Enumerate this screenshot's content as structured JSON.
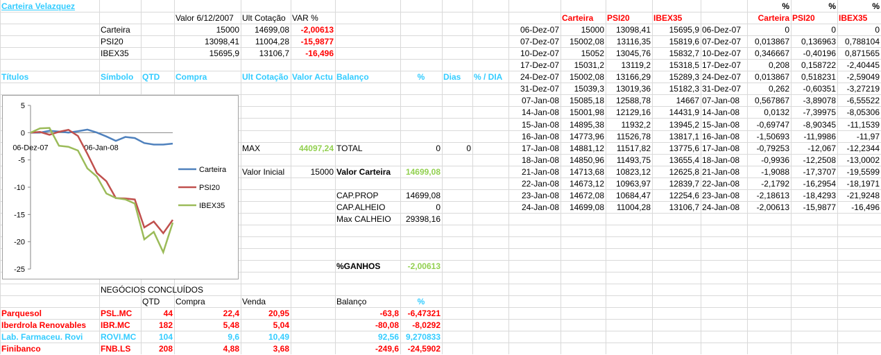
{
  "title": "Carteira Velazquez",
  "summary": {
    "headers": [
      "Valor 6/12/2007",
      "Ult Cotação",
      "VAR %"
    ],
    "rows": [
      {
        "name": "Carteira",
        "valor": "15000",
        "ult": "14699,08",
        "var": "-2,00613"
      },
      {
        "name": "PSI20",
        "valor": "13098,41",
        "ult": "11004,28",
        "var": "-15,9877"
      },
      {
        "name": "IBEX35",
        "valor": "15695,9",
        "ult": "13106,7",
        "var": "-16,496"
      }
    ]
  },
  "titulos_headers": {
    "titulos": "Títulos",
    "simbolo": "Símbolo",
    "qtd": "QTD",
    "compra": "Compra",
    "ult": "Ult Cotação",
    "valor": "Valor Actu",
    "balanco": "Balanço",
    "pct": "%",
    "dias": "Dias",
    "pctdia": "% / DIA"
  },
  "stats": {
    "max_label": "MAX",
    "max_value": "44097,24",
    "total_label": "TOTAL",
    "total_value": "0",
    "total_value2": "0",
    "vinicial_label": "Valor Inicial",
    "vinicial_value": "15000",
    "vcarteira_label": "Valor Carteira",
    "vcarteira_value": "14699,08",
    "capprop_label": "CAP.PROP",
    "capprop_value": "14699,08",
    "capalheio_label": "CAP.ALHEIO",
    "capalheio_value": "0",
    "maxcalheio_label": "Max CALHEIO",
    "maxcalheio_value": "29398,16",
    "ganhos_label": "%GANHOS",
    "ganhos_value": "-2,00613"
  },
  "negocios": {
    "title": "NEGÓCIOS CONCLUÍDOS",
    "headers": {
      "qtd": "QTD",
      "compra": "Compra",
      "venda": "Venda",
      "balanco": "Balanço",
      "pct": "%"
    },
    "rows": [
      {
        "name": "Parquesol",
        "symbol": "PSL.MC",
        "qtd": "44",
        "compra": "22,4",
        "venda": "20,95",
        "balanco": "-63,8",
        "pct": "-6,47321",
        "color": "#ff0000"
      },
      {
        "name": "Iberdrola Renovables",
        "symbol": "IBR.MC",
        "qtd": "182",
        "compra": "5,48",
        "venda": "5,04",
        "balanco": "-80,08",
        "pct": "-8,0292",
        "color": "#ff0000"
      },
      {
        "name": "Lab. Farmaceu. Rovi",
        "symbol": "ROVI.MC",
        "qtd": "104",
        "compra": "9,6",
        "venda": "10,49",
        "balanco": "92,56",
        "pct": "9,270833",
        "color": "#33ccff"
      },
      {
        "name": "Finibanco",
        "symbol": "FNB.LS",
        "qtd": "208",
        "compra": "4,88",
        "venda": "3,68",
        "balanco": "-249,6",
        "pct": "-24,5902",
        "color": "#ff0000"
      }
    ]
  },
  "history": {
    "headers": [
      "Carteira",
      "PSI20",
      "IBEX35"
    ],
    "pct_headers": [
      "%",
      "%",
      "%"
    ],
    "pct_names": [
      "Carteira",
      "PSI20",
      "IBEX35"
    ],
    "rows": [
      {
        "date": "06-Dez-07",
        "c": "15000",
        "p": "13098,41",
        "i": "15695,9",
        "date2": "06-Dez-07",
        "pc": "0",
        "pp": "0",
        "pi": "0"
      },
      {
        "date": "07-Dez-07",
        "c": "15002,08",
        "p": "13116,35",
        "i": "15819,6",
        "date2": "07-Dez-07",
        "pc": "0,013867",
        "pp": "0,136963",
        "pi": "0,788104"
      },
      {
        "date": "10-Dez-07",
        "c": "15052",
        "p": "13045,76",
        "i": "15832,7",
        "date2": "10-Dez-07",
        "pc": "0,346667",
        "pp": "-0,40196",
        "pi": "0,871565"
      },
      {
        "date": "17-Dez-07",
        "c": "15031,2",
        "p": "13119,2",
        "i": "15318,5",
        "date2": "17-Dez-07",
        "pc": "0,208",
        "pp": "0,158722",
        "pi": "-2,40445"
      },
      {
        "date": "24-Dez-07",
        "c": "15002,08",
        "p": "13166,29",
        "i": "15289,3",
        "date2": "24-Dez-07",
        "pc": "0,013867",
        "pp": "0,518231",
        "pi": "-2,59049"
      },
      {
        "date": "31-Dez-07",
        "c": "15039,3",
        "p": "13019,36",
        "i": "15182,3",
        "date2": "31-Dez-07",
        "pc": "0,262",
        "pp": "-0,60351",
        "pi": "-3,27219"
      },
      {
        "date": "07-Jan-08",
        "c": "15085,18",
        "p": "12588,78",
        "i": "14667",
        "date2": "07-Jan-08",
        "pc": "0,567867",
        "pp": "-3,89078",
        "pi": "-6,55522"
      },
      {
        "date": "14-Jan-08",
        "c": "15001,98",
        "p": "12129,16",
        "i": "14431,9",
        "date2": "14-Jan-08",
        "pc": "0,0132",
        "pp": "-7,39975",
        "pi": "-8,05306"
      },
      {
        "date": "15-Jan-08",
        "c": "14895,38",
        "p": "11932,2",
        "i": "13945,2",
        "date2": "15-Jan-08",
        "pc": "-0,69747",
        "pp": "-8,90345",
        "pi": "-11,1539"
      },
      {
        "date": "16-Jan-08",
        "c": "14773,96",
        "p": "11526,78",
        "i": "13817,1",
        "date2": "16-Jan-08",
        "pc": "-1,50693",
        "pp": "-11,9986",
        "pi": "-11,97"
      },
      {
        "date": "17-Jan-08",
        "c": "14881,12",
        "p": "11517,82",
        "i": "13775,6",
        "date2": "17-Jan-08",
        "pc": "-0,79253",
        "pp": "-12,067",
        "pi": "-12,2344"
      },
      {
        "date": "18-Jan-08",
        "c": "14850,96",
        "p": "11493,75",
        "i": "13655,4",
        "date2": "18-Jan-08",
        "pc": "-0,9936",
        "pp": "-12,2508",
        "pi": "-13,0002"
      },
      {
        "date": "21-Jan-08",
        "c": "14713,68",
        "p": "10823,12",
        "i": "12625,8",
        "date2": "21-Jan-08",
        "pc": "-1,9088",
        "pp": "-17,3707",
        "pi": "-19,5599"
      },
      {
        "date": "22-Jan-08",
        "c": "14673,12",
        "p": "10963,97",
        "i": "12839,7",
        "date2": "22-Jan-08",
        "pc": "-2,1792",
        "pp": "-16,2954",
        "pi": "-18,1971"
      },
      {
        "date": "23-Jan-08",
        "c": "14672,08",
        "p": "10684,47",
        "i": "12254,6",
        "date2": "23-Jan-08",
        "pc": "-2,18613",
        "pp": "-18,4293",
        "pi": "-21,9248"
      },
      {
        "date": "24-Jan-08",
        "c": "14699,08",
        "p": "11004,28",
        "i": "13106,7",
        "date2": "24-Jan-08",
        "pc": "-2,00613",
        "pp": "-15,9877",
        "pi": "-16,496"
      }
    ]
  },
  "chart_data": {
    "type": "line",
    "x": [
      "06-Dez-07",
      "07-Dez-07",
      "10-Dez-07",
      "17-Dez-07",
      "24-Dez-07",
      "31-Dez-07",
      "07-Jan-08",
      "14-Jan-08",
      "15-Jan-08",
      "16-Jan-08",
      "17-Jan-08",
      "18-Jan-08",
      "21-Jan-08",
      "22-Jan-08",
      "23-Jan-08",
      "24-Jan-08"
    ],
    "x_tick_labels": [
      "06-Dez-07",
      "06-Jan-08"
    ],
    "ylim": [
      -25,
      5
    ],
    "y_ticks": [
      5,
      0,
      -5,
      -10,
      -15,
      -20,
      -25
    ],
    "legend_position": "right",
    "series": [
      {
        "name": "Carteira",
        "color": "#4f81bd",
        "values": [
          0,
          0.013867,
          0.346667,
          0.208,
          0.013867,
          0.262,
          0.567867,
          0.0132,
          -0.69747,
          -1.50693,
          -0.79253,
          -0.9936,
          -1.9088,
          -2.1792,
          -2.18613,
          -2.00613
        ]
      },
      {
        "name": "PSI20",
        "color": "#c0504d",
        "values": [
          0,
          0.136963,
          -0.40196,
          0.158722,
          0.518231,
          -0.60351,
          -3.89078,
          -7.39975,
          -8.90345,
          -11.9986,
          -12.067,
          -12.2508,
          -17.3707,
          -16.2954,
          -18.4293,
          -15.9877
        ]
      },
      {
        "name": "IBEX35",
        "color": "#9bbb59",
        "values": [
          0,
          0.788104,
          0.871565,
          -2.40445,
          -2.59049,
          -3.27219,
          -6.55522,
          -8.05306,
          -11.1539,
          -11.97,
          -12.2344,
          -13.0002,
          -19.5599,
          -18.1971,
          -21.9248,
          -16.496
        ]
      }
    ]
  }
}
